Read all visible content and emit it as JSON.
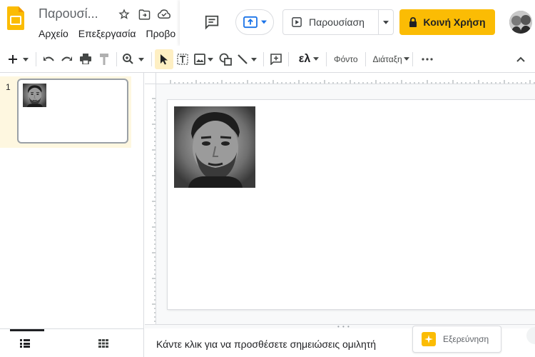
{
  "header": {
    "doc_title": "Παρουσί...",
    "menu": [
      "Αρχείο",
      "Επεξεργασία",
      "Προβο"
    ],
    "present_label": "Παρουσίαση",
    "share_label": "Κοινή Χρήση",
    "colors": {
      "share": "#fbbc04",
      "present_mode": "#1a73e8",
      "slides_logo": "#fbbc04"
    },
    "icons": [
      "slides-logo-icon",
      "star-icon",
      "move-folder-icon",
      "cloud-status-icon",
      "comments-icon",
      "present-mode-icon",
      "play-icon",
      "lock-icon"
    ]
  },
  "toolbar": {
    "lang_label": "ελ",
    "background_label": "Φόντο",
    "layout_label": "Διάταξη",
    "icons": [
      "new-slide-icon",
      "undo-icon",
      "redo-icon",
      "print-icon",
      "paint-format-icon",
      "zoom-icon",
      "select-icon",
      "text-box-icon",
      "image-icon",
      "shape-icon",
      "line-icon",
      "comment-add-icon",
      "more-icon",
      "collapse-icon"
    ]
  },
  "filmstrip": {
    "slides": [
      {
        "number": "1"
      }
    ]
  },
  "notes": {
    "placeholder": "Κάντε κλικ για να προσθέσετε σημειώσεις ομιλητή"
  },
  "explore": {
    "label": "Εξερεύνηση"
  }
}
